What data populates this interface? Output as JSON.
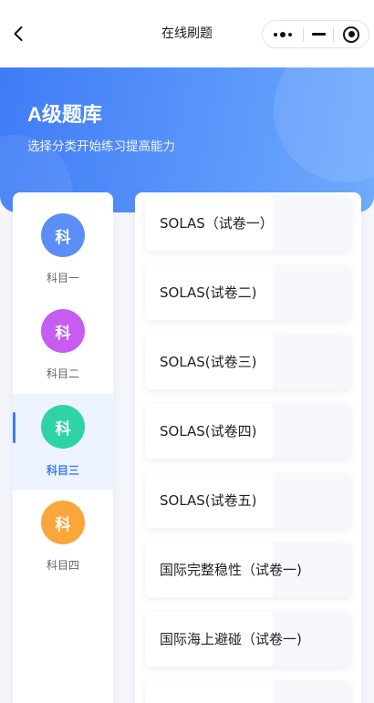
{
  "navbar": {
    "title": "在线刷题"
  },
  "hero": {
    "title": "A级题库",
    "subtitle": "选择分类开始练习提高能力"
  },
  "subjects": [
    {
      "icon_text": "科",
      "label": "科目一",
      "color": "#5b8ef9",
      "active": false
    },
    {
      "icon_text": "科",
      "label": "科目二",
      "color": "#c75df0",
      "active": false
    },
    {
      "icon_text": "科",
      "label": "科目三",
      "color": "#2ed3a6",
      "active": true
    },
    {
      "icon_text": "科",
      "label": "科目四",
      "color": "#fba63b",
      "active": false
    }
  ],
  "exams": [
    {
      "label": "SOLAS（试卷一）"
    },
    {
      "label": "SOLAS(试卷二)"
    },
    {
      "label": "SOLAS(试卷三)"
    },
    {
      "label": "SOLAS(试卷四)"
    },
    {
      "label": "SOLAS(试卷五)"
    },
    {
      "label": "国际完整稳性（试卷一)"
    },
    {
      "label": "国际海上避碰（试卷一)"
    },
    {
      "label": ""
    }
  ],
  "colors": {
    "accent": "#3f7bf6",
    "hero_start": "#3f7bf6",
    "hero_end": "#70aafc"
  }
}
